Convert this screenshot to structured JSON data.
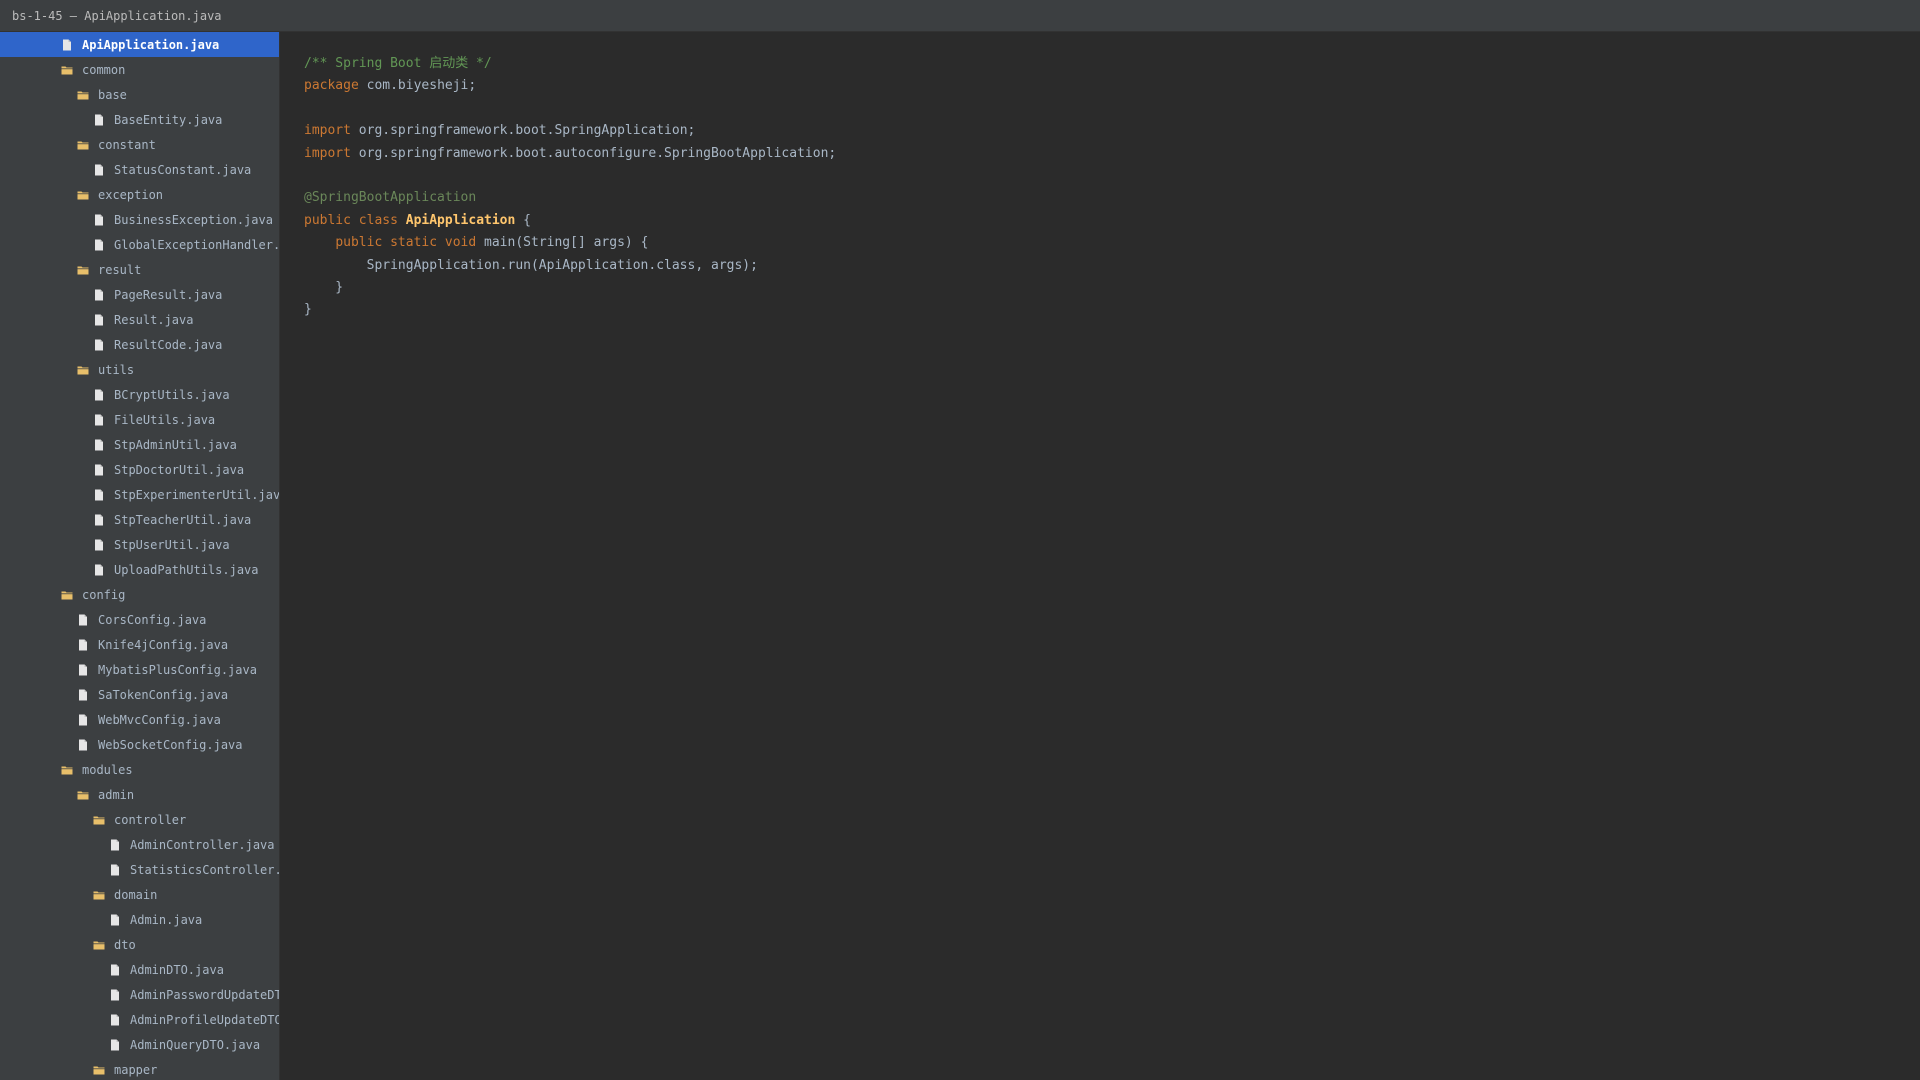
{
  "window": {
    "title": "bs-1-45 — ApiApplication.java"
  },
  "colors": {
    "background": "#2b2b2b",
    "sidebar": "#3c3f41",
    "selection": "#2f65ca",
    "keyword": "#cc7832",
    "comment": "#629755",
    "annotation": "#6a8759",
    "classname": "#ffc66d",
    "text": "#a9b7c6",
    "folder_icon": "#e8bf6a",
    "file_icon": "#e6e6e6"
  },
  "tree": [
    {
      "label": "ApiApplication.java",
      "kind": "file",
      "depth": 0,
      "selected": true
    },
    {
      "label": "common",
      "kind": "folder",
      "depth": 0
    },
    {
      "label": "base",
      "kind": "folder",
      "depth": 1
    },
    {
      "label": "BaseEntity.java",
      "kind": "file",
      "depth": 2
    },
    {
      "label": "constant",
      "kind": "folder",
      "depth": 1
    },
    {
      "label": "StatusConstant.java",
      "kind": "file",
      "depth": 2
    },
    {
      "label": "exception",
      "kind": "folder",
      "depth": 1
    },
    {
      "label": "BusinessException.java",
      "kind": "file",
      "depth": 2
    },
    {
      "label": "GlobalExceptionHandler.java",
      "kind": "file",
      "depth": 2
    },
    {
      "label": "result",
      "kind": "folder",
      "depth": 1
    },
    {
      "label": "PageResult.java",
      "kind": "file",
      "depth": 2
    },
    {
      "label": "Result.java",
      "kind": "file",
      "depth": 2
    },
    {
      "label": "ResultCode.java",
      "kind": "file",
      "depth": 2
    },
    {
      "label": "utils",
      "kind": "folder",
      "depth": 1
    },
    {
      "label": "BCryptUtils.java",
      "kind": "file",
      "depth": 2
    },
    {
      "label": "FileUtils.java",
      "kind": "file",
      "depth": 2
    },
    {
      "label": "StpAdminUtil.java",
      "kind": "file",
      "depth": 2
    },
    {
      "label": "StpDoctorUtil.java",
      "kind": "file",
      "depth": 2
    },
    {
      "label": "StpExperimenterUtil.java",
      "kind": "file",
      "depth": 2
    },
    {
      "label": "StpTeacherUtil.java",
      "kind": "file",
      "depth": 2
    },
    {
      "label": "StpUserUtil.java",
      "kind": "file",
      "depth": 2
    },
    {
      "label": "UploadPathUtils.java",
      "kind": "file",
      "depth": 2
    },
    {
      "label": "config",
      "kind": "folder",
      "depth": 0
    },
    {
      "label": "CorsConfig.java",
      "kind": "file",
      "depth": 1
    },
    {
      "label": "Knife4jConfig.java",
      "kind": "file",
      "depth": 1
    },
    {
      "label": "MybatisPlusConfig.java",
      "kind": "file",
      "depth": 1
    },
    {
      "label": "SaTokenConfig.java",
      "kind": "file",
      "depth": 1
    },
    {
      "label": "WebMvcConfig.java",
      "kind": "file",
      "depth": 1
    },
    {
      "label": "WebSocketConfig.java",
      "kind": "file",
      "depth": 1
    },
    {
      "label": "modules",
      "kind": "folder",
      "depth": 0
    },
    {
      "label": "admin",
      "kind": "folder",
      "depth": 1
    },
    {
      "label": "controller",
      "kind": "folder",
      "depth": 2
    },
    {
      "label": "AdminController.java",
      "kind": "file",
      "depth": 3
    },
    {
      "label": "StatisticsController.java",
      "kind": "file",
      "depth": 3
    },
    {
      "label": "domain",
      "kind": "folder",
      "depth": 2
    },
    {
      "label": "Admin.java",
      "kind": "file",
      "depth": 3
    },
    {
      "label": "dto",
      "kind": "folder",
      "depth": 2
    },
    {
      "label": "AdminDTO.java",
      "kind": "file",
      "depth": 3
    },
    {
      "label": "AdminPasswordUpdateDTO.java",
      "kind": "file",
      "depth": 3
    },
    {
      "label": "AdminProfileUpdateDTO.java",
      "kind": "file",
      "depth": 3
    },
    {
      "label": "AdminQueryDTO.java",
      "kind": "file",
      "depth": 3
    },
    {
      "label": "mapper",
      "kind": "folder",
      "depth": 2
    }
  ],
  "code": [
    [
      {
        "t": "/** Spring Boot 启动类 */",
        "k": "comment"
      }
    ],
    [
      {
        "t": "package",
        "k": "keyword"
      },
      {
        "t": " com.biyesheji;",
        "k": "plain"
      }
    ],
    [],
    [
      {
        "t": "import",
        "k": "keyword"
      },
      {
        "t": " org.springframework.boot.SpringApplication;",
        "k": "plain"
      }
    ],
    [
      {
        "t": "import",
        "k": "keyword"
      },
      {
        "t": " org.springframework.boot.autoconfigure.SpringBootApplication;",
        "k": "plain"
      }
    ],
    [],
    [
      {
        "t": "@SpringBootApplication",
        "k": "annotation"
      }
    ],
    [
      {
        "t": "public class ",
        "k": "keyword"
      },
      {
        "t": "ApiApplication",
        "k": "classname"
      },
      {
        "t": " {",
        "k": "plain"
      }
    ],
    [
      {
        "t": "    ",
        "k": "plain"
      },
      {
        "t": "public static void ",
        "k": "keyword"
      },
      {
        "t": "main(String[] args) {",
        "k": "plain"
      }
    ],
    [
      {
        "t": "        SpringApplication.run(ApiApplication.class, args);",
        "k": "plain"
      }
    ],
    [
      {
        "t": "    }",
        "k": "plain"
      }
    ],
    [
      {
        "t": "}",
        "k": "plain"
      }
    ]
  ]
}
